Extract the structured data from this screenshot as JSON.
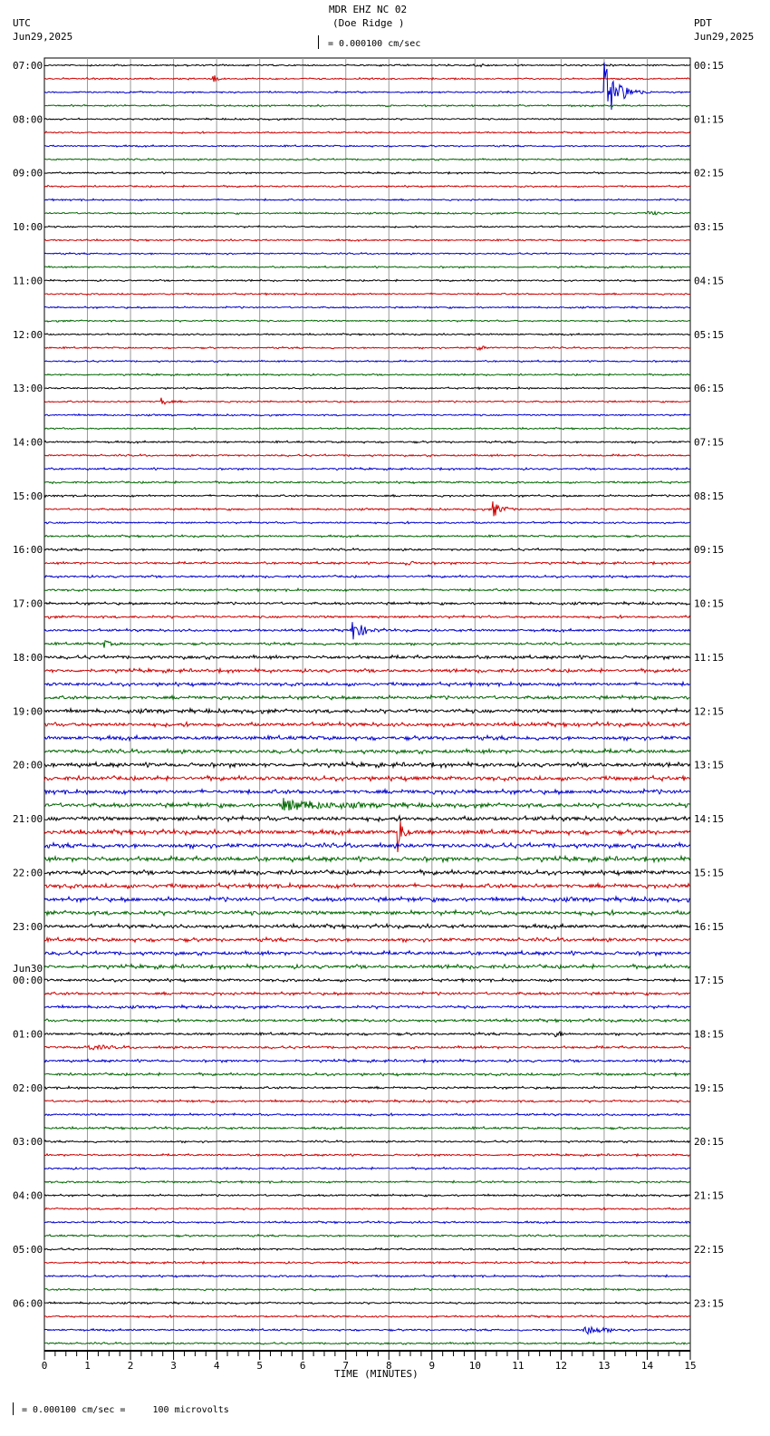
{
  "header": {
    "title": "MDR EHZ NC 02",
    "subtitle": "(Doe Ridge )",
    "left_tz": "UTC",
    "left_date": "Jun29,2025",
    "right_tz": "PDT",
    "right_date": "Jun29,2025",
    "scale_text": "= 0.000100 cm/sec"
  },
  "footer": {
    "scale_text": "= 0.000100 cm/sec =     100 microvolts"
  },
  "chart_data": {
    "type": "line",
    "title": "MDR EHZ NC 02 (Doe Ridge )",
    "xlabel": "TIME (MINUTES)",
    "xlim": [
      0,
      15
    ],
    "x_ticks": [
      "0",
      "1",
      "2",
      "3",
      "4",
      "5",
      "6",
      "7",
      "8",
      "9",
      "10",
      "11",
      "12",
      "13",
      "14",
      "15"
    ],
    "traces_per_hour": 4,
    "trace_colors": [
      "#000000",
      "#cc0000",
      "#0000cc",
      "#006600"
    ],
    "left_labels": [
      "07:00",
      "08:00",
      "09:00",
      "10:00",
      "11:00",
      "12:00",
      "13:00",
      "14:00",
      "15:00",
      "16:00",
      "17:00",
      "18:00",
      "19:00",
      "20:00",
      "21:00",
      "22:00",
      "23:00",
      "00:00",
      "01:00",
      "02:00",
      "03:00",
      "04:00",
      "05:00",
      "06:00"
    ],
    "date_change_label": "Jun30",
    "right_labels": [
      "00:15",
      "01:15",
      "02:15",
      "03:15",
      "04:15",
      "05:15",
      "06:15",
      "07:15",
      "08:15",
      "09:15",
      "10:15",
      "11:15",
      "12:15",
      "13:15",
      "14:15",
      "15:15",
      "16:15",
      "17:15",
      "18:15",
      "19:15",
      "20:15",
      "21:15",
      "22:15",
      "23:15"
    ],
    "noise_by_hour": [
      0.6,
      0.6,
      0.6,
      0.6,
      0.6,
      0.6,
      0.6,
      0.7,
      0.7,
      0.8,
      0.9,
      1.2,
      1.4,
      1.5,
      1.6,
      1.5,
      1.3,
      1.0,
      0.9,
      0.8,
      0.7,
      0.7,
      0.7,
      0.7
    ],
    "events": [
      {
        "trace": 0,
        "minute": 10.0,
        "duration": 0.4,
        "amplitude": 3
      },
      {
        "trace": 1,
        "minute": 3.9,
        "duration": 0.05,
        "amplitude": 6
      },
      {
        "trace": 2,
        "minute": 13.0,
        "duration": 0.8,
        "amplitude": 35
      },
      {
        "trace": 11,
        "minute": 14.0,
        "duration": 1.0,
        "amplitude": 2
      },
      {
        "trace": 21,
        "minute": 10.05,
        "duration": 0.2,
        "amplitude": 4
      },
      {
        "trace": 25,
        "minute": 2.7,
        "duration": 0.2,
        "amplitude": 5
      },
      {
        "trace": 33,
        "minute": 10.4,
        "duration": 0.4,
        "amplitude": 10
      },
      {
        "trace": 37,
        "minute": 8.3,
        "duration": 0.5,
        "amplitude": 3
      },
      {
        "trace": 42,
        "minute": 7.15,
        "duration": 0.5,
        "amplitude": 14
      },
      {
        "trace": 43,
        "minute": 1.35,
        "duration": 0.2,
        "amplitude": 5
      },
      {
        "trace": 55,
        "minute": 5.5,
        "duration": 3.2,
        "amplitude": 6
      },
      {
        "trace": 57,
        "minute": 8.2,
        "duration": 0.05,
        "amplitude": 28
      },
      {
        "trace": 72,
        "minute": 11.85,
        "duration": 0.15,
        "amplitude": 5
      },
      {
        "trace": 73,
        "minute": 1.0,
        "duration": 1.0,
        "amplitude": 3
      },
      {
        "trace": 94,
        "minute": 12.5,
        "duration": 1.2,
        "amplitude": 6
      }
    ]
  }
}
